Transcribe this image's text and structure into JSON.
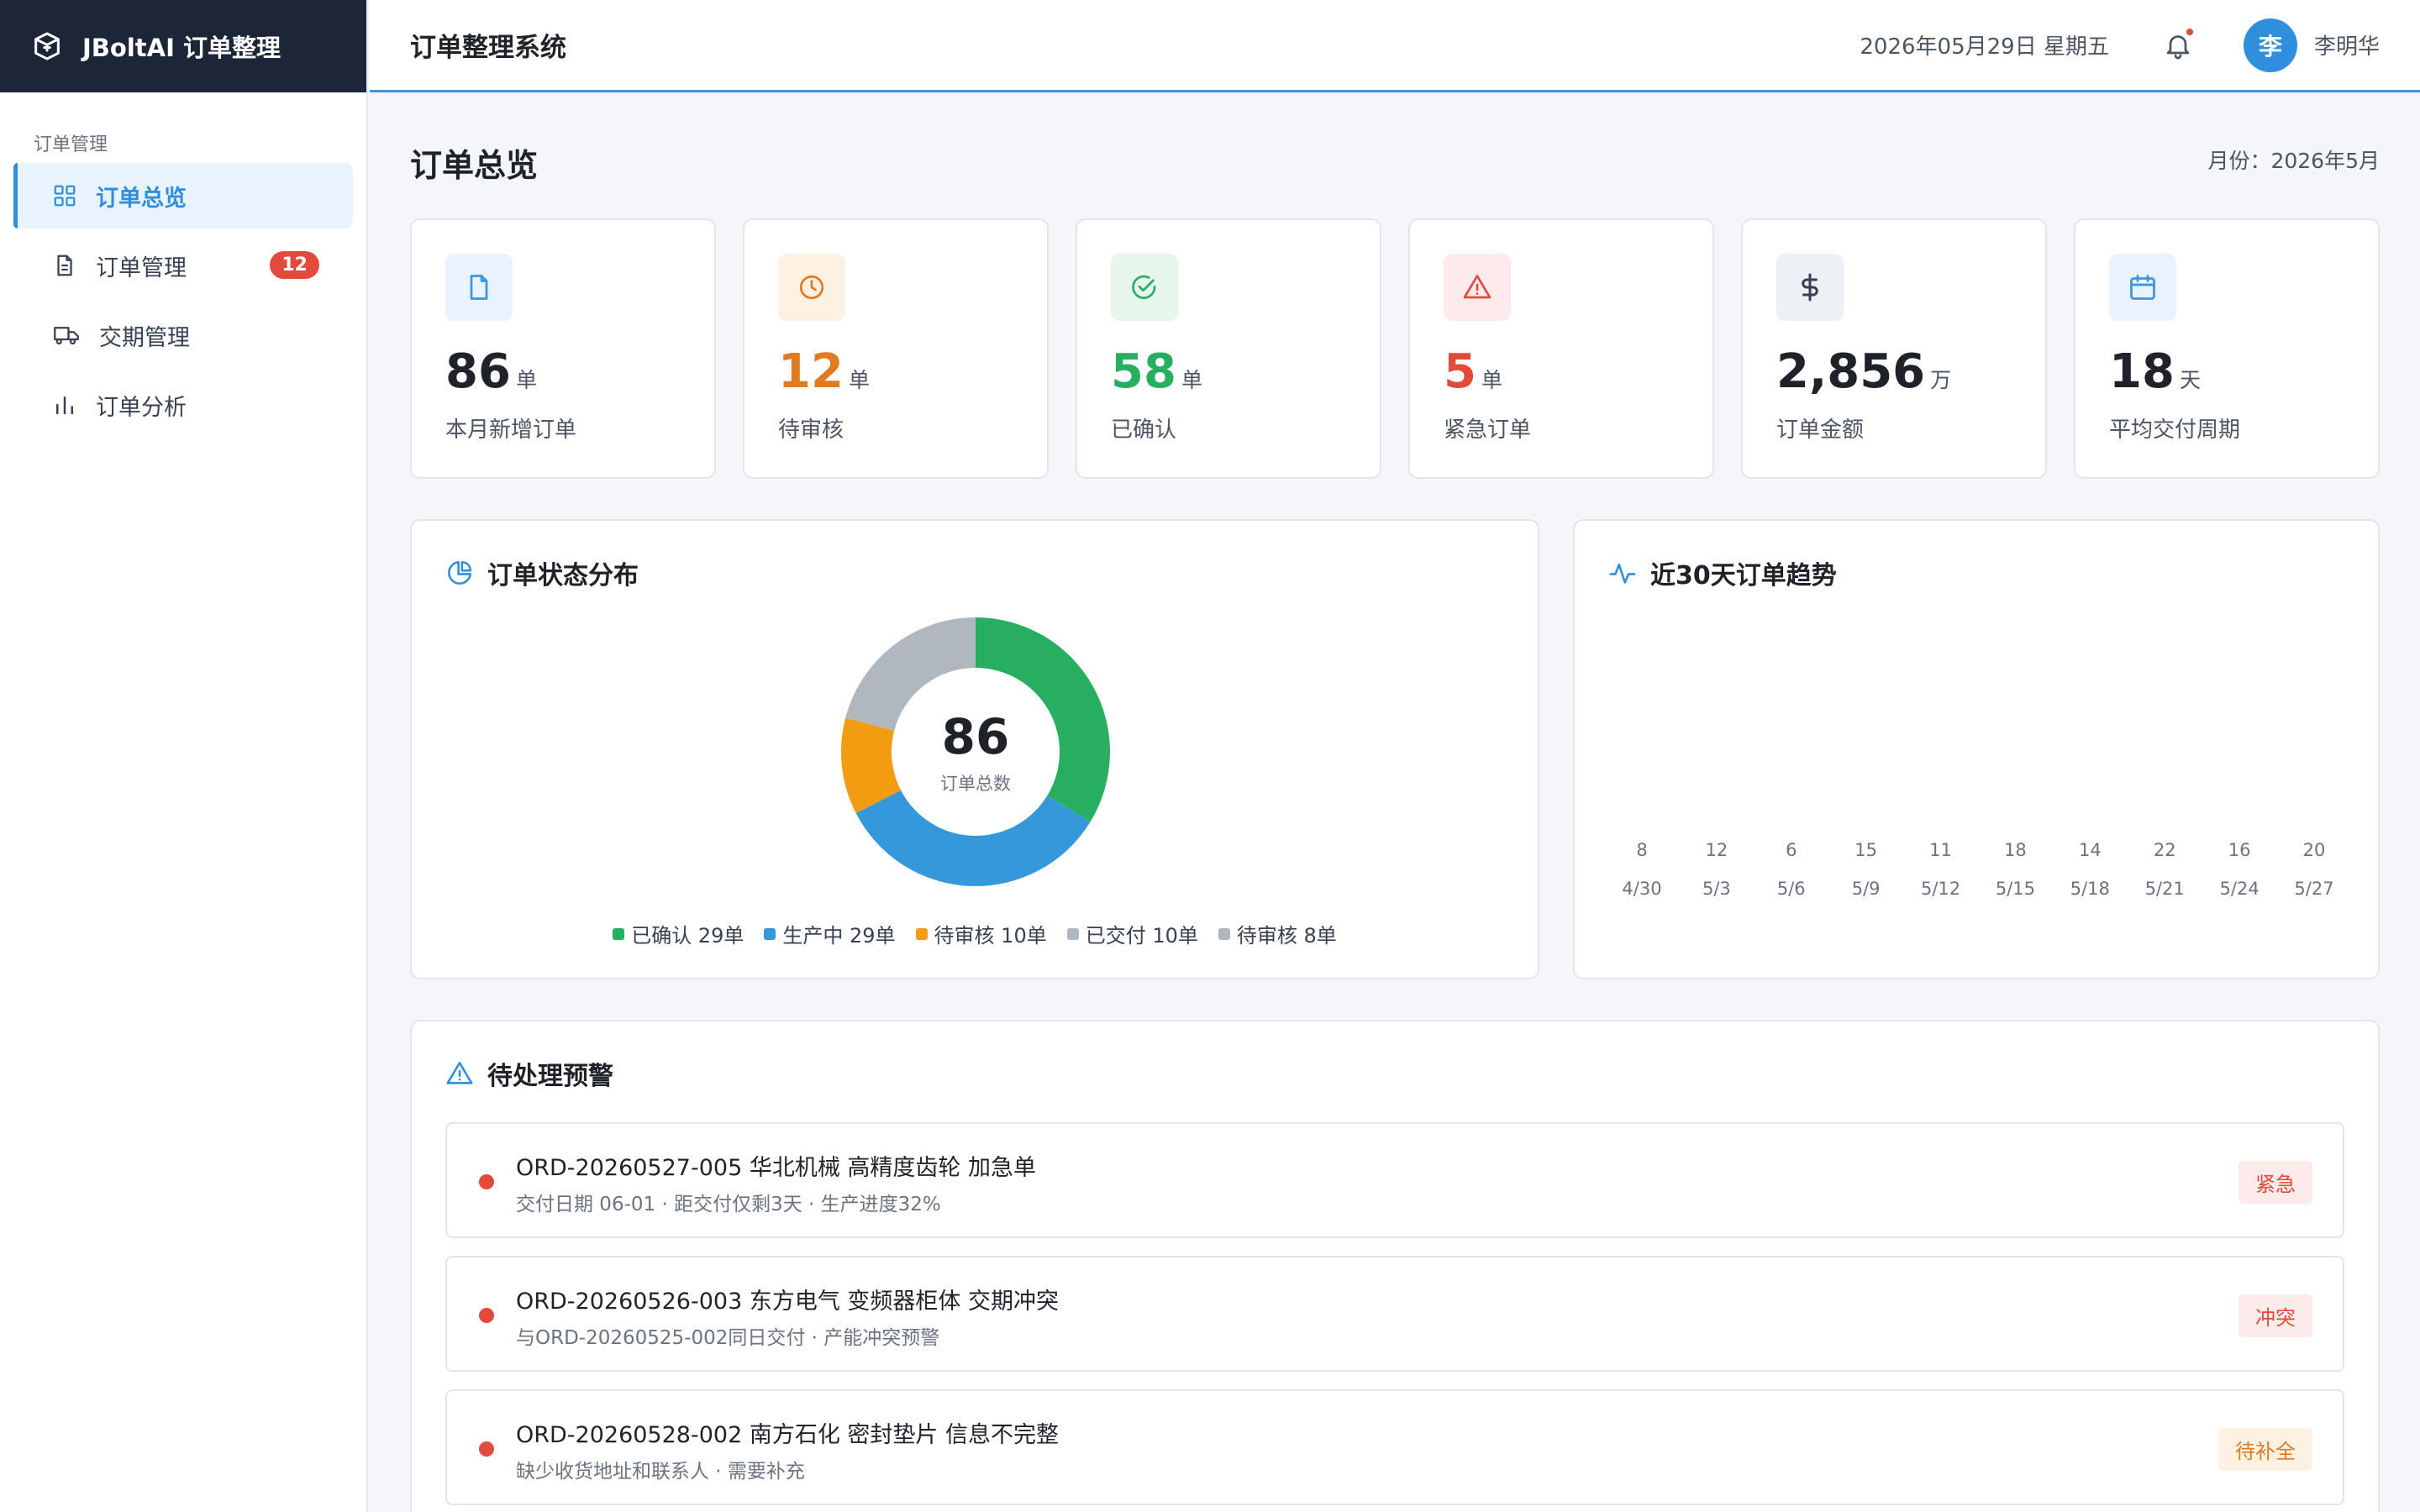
{
  "brand": {
    "name": "JBoltAI 订单整理",
    "icon": "box-plus-icon"
  },
  "sidebar": {
    "section": "订单管理",
    "items": [
      {
        "label": "订单总览",
        "icon": "grid-icon",
        "active": true
      },
      {
        "label": "订单管理",
        "icon": "document-icon",
        "badge": "12"
      },
      {
        "label": "交期管理",
        "icon": "truck-icon"
      },
      {
        "label": "订单分析",
        "icon": "bar-chart-icon"
      }
    ]
  },
  "header": {
    "title": "订单整理系统",
    "date": "2026年05月29日 星期五",
    "avatar_initial": "李",
    "username": "李明华"
  },
  "page": {
    "title": "订单总览",
    "month": "月份：2026年5月"
  },
  "stats": [
    {
      "value": "86",
      "unit": "单",
      "label": "本月新增订单",
      "icon": "document-icon",
      "color": "#1f2329",
      "icon_color": "#3a95de",
      "icon_bg": "#e8f3fd"
    },
    {
      "value": "12",
      "unit": "单",
      "label": "待审核",
      "icon": "clock-icon",
      "color": "#e07b24",
      "icon_color": "#e07b24",
      "icon_bg": "#fdf1e4"
    },
    {
      "value": "58",
      "unit": "单",
      "label": "已确认",
      "icon": "check-circle-icon",
      "color": "#27ae60",
      "icon_color": "#27ae60",
      "icon_bg": "#e6f6ec"
    },
    {
      "value": "5",
      "unit": "单",
      "label": "紧急订单",
      "icon": "warning-icon",
      "color": "#e24a3b",
      "icon_color": "#e24a3b",
      "icon_bg": "#fdeaea"
    },
    {
      "value": "2,856",
      "unit": "万",
      "label": "订单金额",
      "icon": "dollar-icon",
      "color": "#1f2329",
      "icon_color": "#374151",
      "icon_bg": "#edf0f4"
    },
    {
      "value": "18",
      "unit": "天",
      "label": "平均交付周期",
      "icon": "calendar-icon",
      "color": "#1f2329",
      "icon_color": "#3a95de",
      "icon_bg": "#e8f3fd"
    }
  ],
  "status_panel": {
    "title": "订单状态分布",
    "icon": "pie-chart-icon",
    "total": "86",
    "total_label": "订单总数"
  },
  "trend_panel": {
    "title": "近30天订单趋势",
    "icon": "activity-icon"
  },
  "chart_data": [
    {
      "type": "pie",
      "categories": [
        "已确认",
        "生产中",
        "待审核",
        "已交付",
        "待审核"
      ],
      "values": [
        29,
        29,
        8,
        10,
        10
      ],
      "legend": [
        "已确认 29单",
        "生产中 29单",
        "待审核 10单",
        "已交付 10单",
        "待审核 8单"
      ],
      "legend_colors": [
        "#27ae60",
        "#3498db",
        "#f39c12",
        "#b0b7bf",
        "#b0b7bf"
      ],
      "slice_colors": [
        "#27ae60",
        "#3498db",
        "#f39c12",
        "#b0b7bf"
      ],
      "slice_values": [
        29,
        29,
        10,
        18
      ],
      "legend_position": "bottom"
    },
    {
      "type": "bar",
      "categories": [
        "4/30",
        "5/3",
        "5/6",
        "5/9",
        "5/12",
        "5/15",
        "5/18",
        "5/21",
        "5/24",
        "5/27"
      ],
      "values": [
        8,
        12,
        6,
        15,
        11,
        18,
        14,
        22,
        16,
        20
      ]
    }
  ],
  "alerts_panel": {
    "title": "待处理预警",
    "icon": "warning-icon",
    "items": [
      {
        "title": "ORD-20260527-005 华北机械 高精度齿轮 加急单",
        "sub": "交付日期 06-01 · 距交付仅剩3天 · 生产进度32%",
        "tag": "紧急",
        "tag_color": "#e24a3b",
        "tag_bg": "#fdeaea"
      },
      {
        "title": "ORD-20260526-003 东方电气 变频器柜体 交期冲突",
        "sub": "与ORD-20260525-002同日交付 · 产能冲突预警",
        "tag": "冲突",
        "tag_color": "#e24a3b",
        "tag_bg": "#fdeaea"
      },
      {
        "title": "ORD-20260528-002 南方石化 密封垫片 信息不完整",
        "sub": "缺少收货地址和联系人 · 需要补充",
        "tag": "待补全",
        "tag_color": "#e07b24",
        "tag_bg": "#fdf1e4"
      }
    ]
  }
}
